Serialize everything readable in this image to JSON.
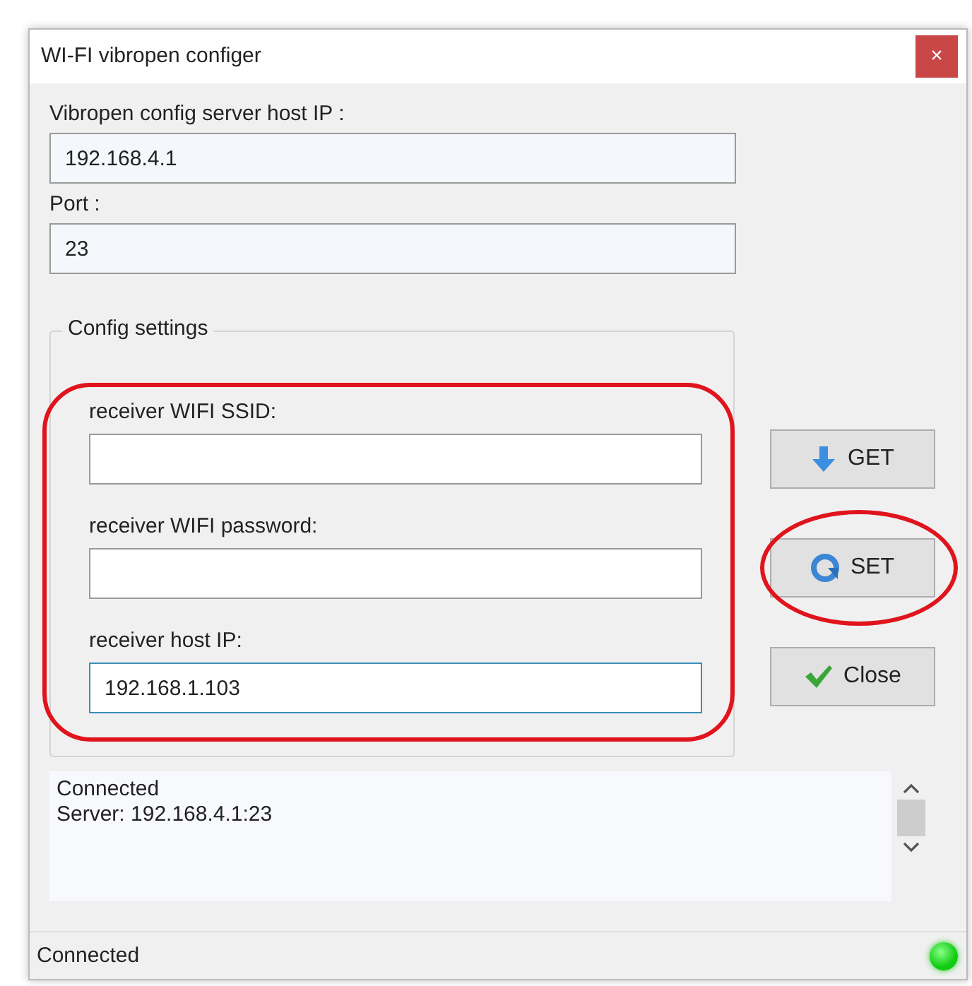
{
  "window": {
    "title": "WI-FI vibropen configer",
    "close_glyph": "×"
  },
  "server_fields": [
    {
      "label": "Vibropen config server host IP :",
      "value": "192.168.4.1"
    },
    {
      "label": "Port :",
      "value": "23"
    }
  ],
  "config_group": {
    "legend": "Config settings",
    "highlighted": true,
    "fields": [
      {
        "label": "receiver WIFI SSID:",
        "focused": false
      },
      {
        "label": "receiver WIFI password:",
        "focused": false
      },
      {
        "label": "receiver host IP:",
        "value": "192.168.1.103",
        "focused": true
      }
    ]
  },
  "buttons": [
    {
      "label": "GET",
      "kind": "get",
      "highlighted": false
    },
    {
      "label": "SET",
      "kind": "set",
      "highlighted": true
    },
    {
      "label": "Close",
      "kind": "close",
      "highlighted": false
    }
  ],
  "log": {
    "lines": [
      "Connected",
      "Server: 192.168.4.1:23"
    ]
  },
  "status_bar": {
    "text": "Connected",
    "connected": true
  }
}
